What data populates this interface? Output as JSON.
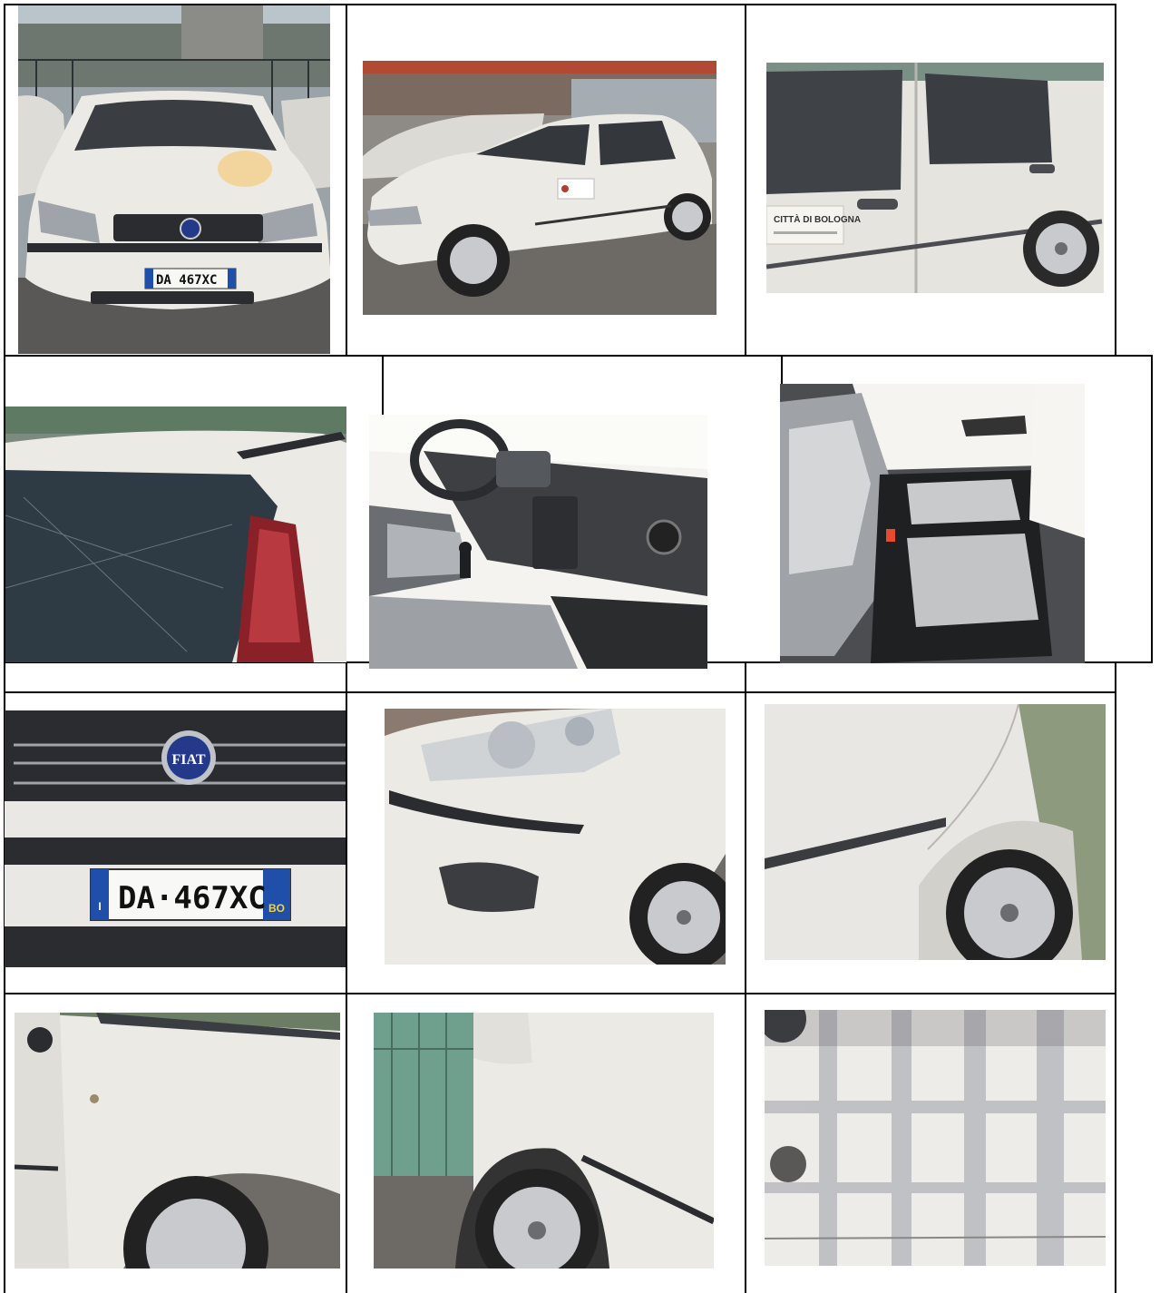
{
  "document": {
    "photos": [
      {
        "id": "front-view"
      },
      {
        "id": "front-side-view"
      },
      {
        "id": "side-doors-view"
      },
      {
        "id": "rear-window-taillight"
      },
      {
        "id": "dashboard-interior"
      },
      {
        "id": "rear-seat-interior"
      },
      {
        "id": "front-grille-plate"
      },
      {
        "id": "front-bumper-headlight"
      },
      {
        "id": "rear-wheel-damage"
      },
      {
        "id": "front-fender-damage"
      },
      {
        "id": "rear-quarter-wheel"
      },
      {
        "id": "panel-shadow-closeup"
      }
    ],
    "plate_text": "DA 467XC",
    "plate_text_closeup": "DA·467XC",
    "plate_country": "I",
    "plate_province": "BO",
    "brand_badge": "FIAT",
    "door_sign_line1": "CITTÀ DI BOLOGNA"
  },
  "colors": {
    "car_white": "#eceae4",
    "euro_blue": "#1f4fa8",
    "fiat_blue": "#24398a",
    "asphalt": "#6d6a66"
  }
}
